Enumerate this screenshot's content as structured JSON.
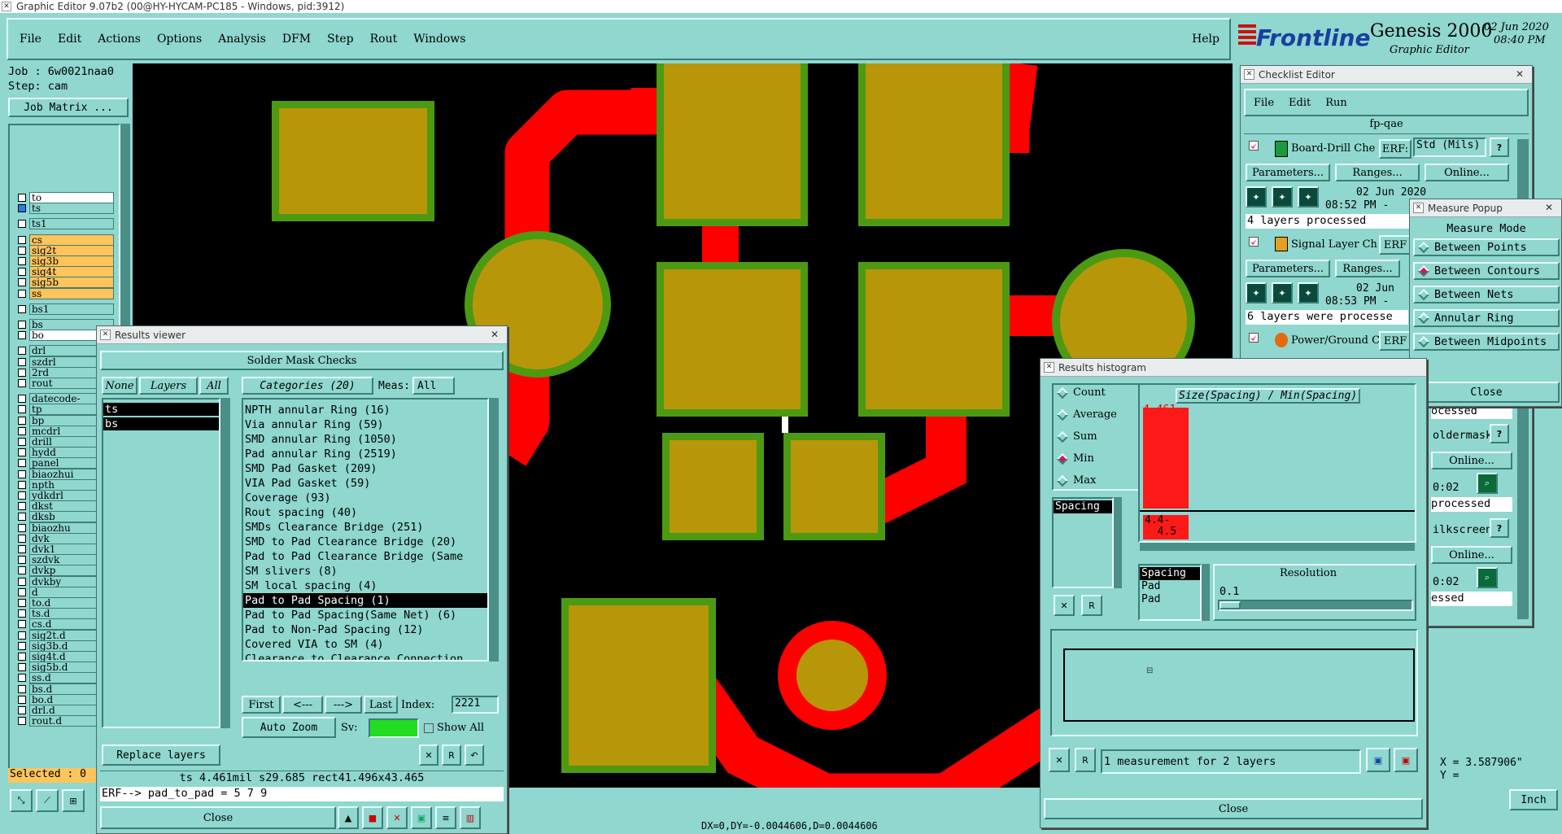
{
  "window_title": "Graphic Editor 9.07b2 (00@HY-HYCAM-PC185 - Windows, pid:3912)",
  "menu": [
    "File",
    "Edit",
    "Actions",
    "Options",
    "Analysis",
    "DFM",
    "Step",
    "Rout",
    "Windows"
  ],
  "help": "Help",
  "brand": {
    "logo": "Frontline",
    "product": "Genesis 2000",
    "sub": "Graphic Editor",
    "date": "02 Jun 2020",
    "time": "08:40 PM"
  },
  "job": {
    "job_label": "Job : 6w0021naa0",
    "step_label": "Step: cam",
    "matrix_btn": "Job Matrix ..."
  },
  "layers": [
    "to",
    "ts",
    "ts1",
    "cs",
    "sig2t",
    "sig3b",
    "sig4t",
    "sig5b",
    "ss",
    "bs1",
    "bs",
    "bo",
    "drl",
    "szdrl",
    "2rd",
    "rout",
    "datecode-",
    "tp",
    "bp",
    "mcdrl",
    "drill",
    "hydd",
    "panel",
    "biaozhui",
    "npth",
    "ydkdrl",
    "dkst",
    "dksb",
    "biaozhu",
    "dvk",
    "dvk1",
    "szdvk",
    "dvkp",
    "dvkby",
    "d",
    "to.d",
    "ts.d",
    "cs.d",
    "sig2t.d",
    "sig3b.d",
    "sig4t.d",
    "sig5b.d",
    "ss.d",
    "bs.d",
    "bo.d",
    "drl.d",
    "rout.d"
  ],
  "selected_count": "Selected : 0",
  "status_bar": "DX=0,DY=-0.0044606,D=0.0044606",
  "coords": {
    "x": "X = 3.587906\"",
    "y": "Y = ",
    "unit": "Inch"
  },
  "results_viewer": {
    "title": "Results viewer",
    "header": "Solder Mask Checks",
    "none": "None",
    "layers_label": "Layers",
    "all": "All",
    "layer_list": [
      "ts",
      "bs"
    ],
    "categories_label": "Categories (20)",
    "meas_label": "Meas:",
    "meas_value": "All",
    "categories": [
      "NPTH annular Ring (16)",
      "Via annular Ring (59)",
      "SMD annular Ring (1050)",
      "Pad annular Ring (2519)",
      "SMD Pad Gasket (209)",
      "VIA Pad Gasket (59)",
      "Coverage (93)",
      "Rout spacing (40)",
      "SMDs Clearance Bridge (251)",
      "SMD to Pad Clearance Bridge (20)",
      "Pad to Pad Clearance Bridge (Same",
      "SM slivers (8)",
      "SM local spacing (4)",
      "Pad to Pad Spacing (1)",
      "Pad to Pad Spacing(Same Net) (6)",
      "Pad to Non-Pad Spacing (12)",
      "Covered VIA to SM (4)",
      "Clearance to Clearance Connection"
    ],
    "selected_index": 13,
    "first": "First",
    "prev": "<---",
    "next": "--->",
    "last": "Last",
    "index_label": "Index:",
    "index_value": "2221",
    "auto_zoom": "Auto Zoom",
    "sv_label": "Sv:",
    "show_all": "Show All",
    "replace_layers": "Replace layers",
    "info": "ts 4.461mil  s29.685  rect41.496x43.465",
    "erf": "ERF--> pad_to_pad = 5 7 9",
    "close": "Close"
  },
  "checklist": {
    "title": "Checklist Editor",
    "menu": [
      "File",
      "Edit",
      "Run"
    ],
    "name": "fp-qae",
    "items": [
      {
        "label": "Board-Drill Che",
        "erf": "ERF:",
        "erf_val": "Std (Mils)",
        "date": "02 Jun 2020",
        "time": "08:52 PM -",
        "status": "4 layers processed"
      },
      {
        "label": "Signal Layer Ch",
        "erf": "ERF",
        "date": "02 Jun",
        "time": "08:53 PM -",
        "status": "6 layers were processe"
      },
      {
        "label": "Power/Ground C",
        "erf": "ERF"
      }
    ],
    "params": "Parameters...",
    "ranges": "Ranges...",
    "online": "Online...",
    "right_fragments": [
      "ocessed",
      "oldermask",
      "Online...",
      "0:02",
      "processed",
      "ilkscreen",
      "Online...",
      "0:02",
      "essed"
    ]
  },
  "measure": {
    "title": "Measure Popup",
    "mode": "Measure Mode",
    "options": [
      "Between Points",
      "Between Contours",
      "Between Nets",
      "Annular Ring",
      "Between Midpoints"
    ],
    "selected": 1,
    "close": "Close"
  },
  "histogram": {
    "title": "Results histogram",
    "stats": [
      "Count",
      "Average",
      "Sum",
      "Min",
      "Max"
    ],
    "selected": 3,
    "list_label": "Spacing",
    "graph_title": "Size(Spacing) / Min(Spacing)",
    "bar_value": "4.461",
    "bar_fraction": 1,
    "range_label": "4.4-\n  4.5",
    "legend": [
      "Spacing",
      "Pad",
      "Pad"
    ],
    "resolution_label": "Resolution",
    "resolution_value": "0.1",
    "message": "1 measurement for 2 layers",
    "close": "Close"
  },
  "colors": {
    "copper": "#b8960a",
    "mask": "#4c9a12",
    "trace": "#ff0000",
    "ui": "#8fd7cf"
  }
}
